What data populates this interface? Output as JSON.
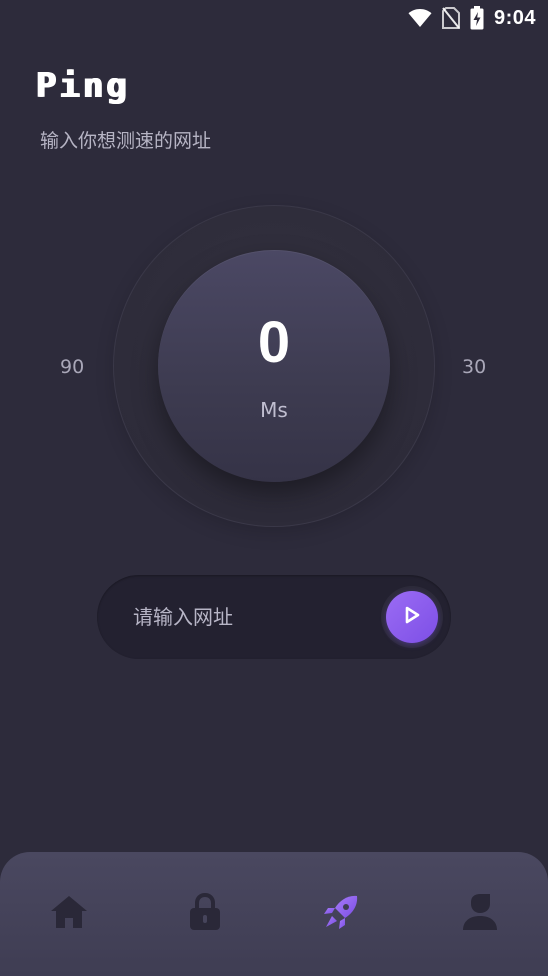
{
  "status_bar": {
    "time": "9:04",
    "icons": [
      "wifi-icon",
      "no-sim-icon",
      "battery-charging-icon"
    ]
  },
  "header": {
    "title": "Ping",
    "subtitle": "输入你想测速的网址"
  },
  "dial": {
    "value": "0",
    "unit": "Ms",
    "scale_left": "90",
    "scale_right": "30"
  },
  "url_bar": {
    "placeholder": "请输入网址",
    "value": ""
  },
  "go_button": {
    "icon": "play-icon"
  },
  "bottom_nav": {
    "items": [
      {
        "icon": "home-icon",
        "active": false
      },
      {
        "icon": "lock-icon",
        "active": false
      },
      {
        "icon": "rocket-icon",
        "active": true
      },
      {
        "icon": "user-icon",
        "active": false
      }
    ]
  },
  "colors": {
    "background": "#2d2b3b",
    "accent": "#8a5cf0",
    "nav_inactive": "#2a2838",
    "text_secondary": "#b6b4c4"
  }
}
